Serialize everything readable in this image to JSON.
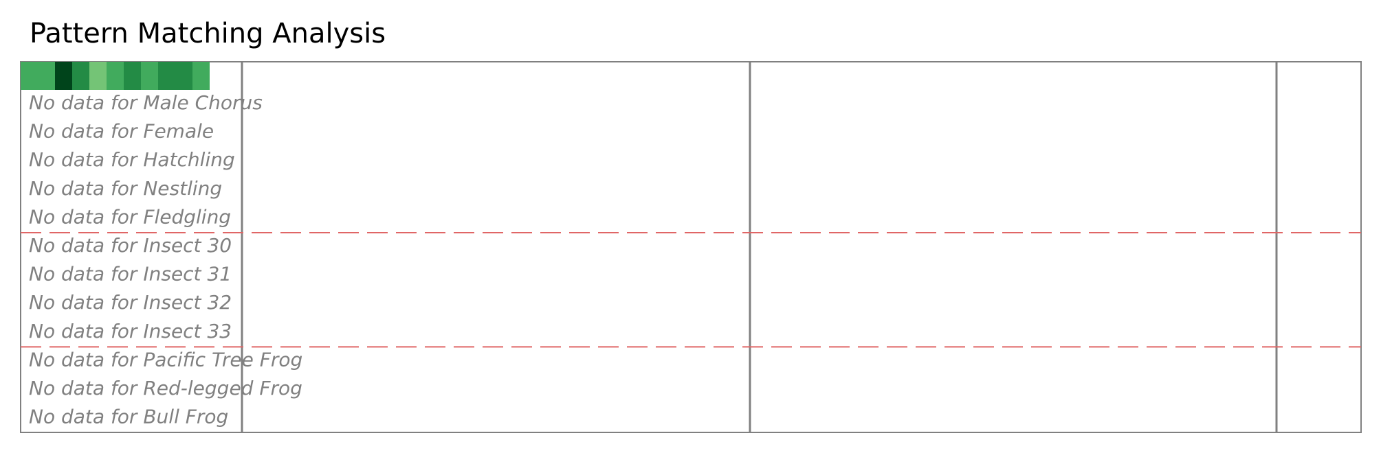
{
  "chart_data": {
    "type": "heatmap",
    "title": "Pattern Matching Analysis",
    "heatmap_row": {
      "values": [
        0.55,
        0.55,
        1.0,
        0.75,
        0.3,
        0.55,
        0.75,
        0.55,
        0.75,
        0.75,
        0.55
      ]
    },
    "colorscale": [
      "#e5f5e0",
      "#a1d99b",
      "#74c476",
      "#41ab5d",
      "#238b45",
      "#00441b"
    ],
    "row_messages": [
      "No data for Male Chorus",
      "No data for Female",
      "No data for Hatchling",
      "No data for Nestling",
      "No data for Fledgling",
      "No data for Insect 30",
      "No data for Insect 31",
      "No data for Insect 32",
      "No data for Insect 33",
      "No data for Pacific Tree Frog",
      "No data for Red-legged Frog",
      "No data for Bull Frog"
    ],
    "group_separator_after_rows": [
      4,
      8
    ],
    "colors": {
      "frame": "#808080",
      "separator": "#e06666",
      "message": "#808080",
      "title": "#000000"
    }
  }
}
